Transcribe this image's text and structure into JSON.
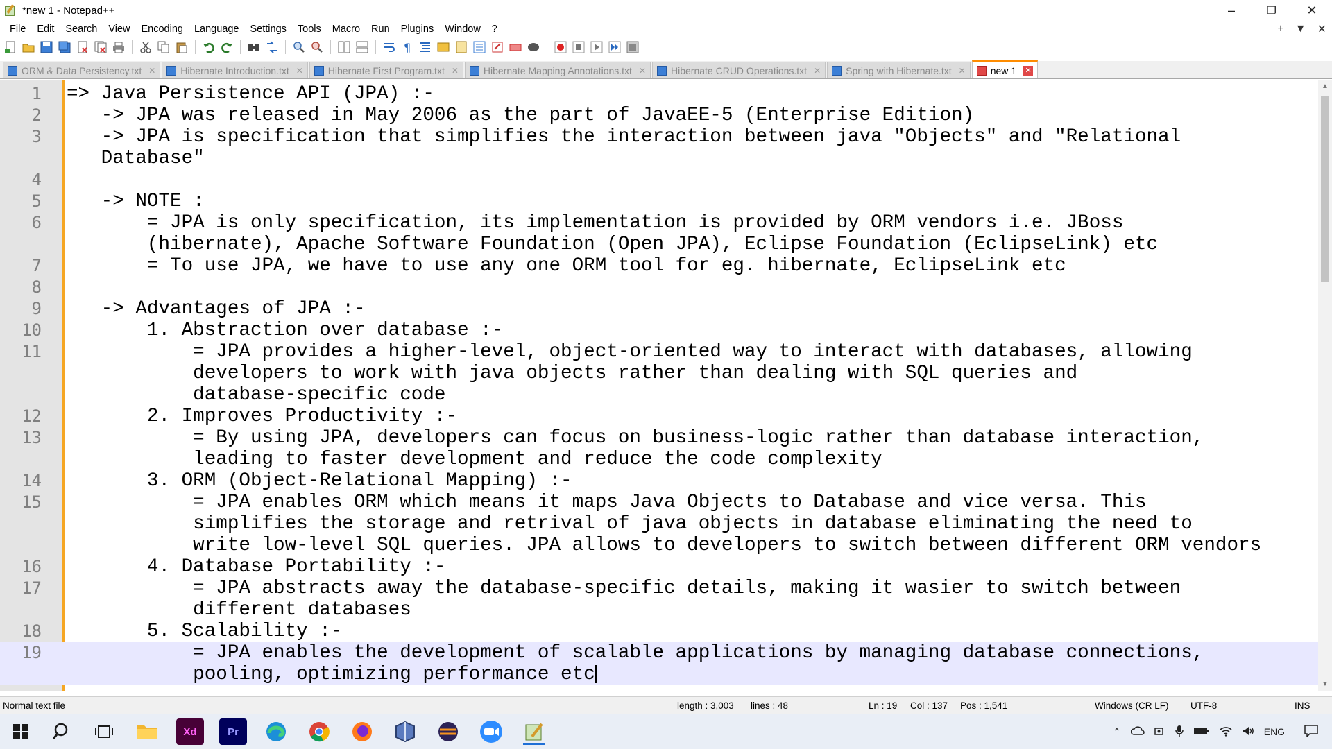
{
  "window": {
    "title": "*new 1 - Notepad++",
    "controls": {
      "minimize": "–",
      "restore": "❐",
      "close": "✕"
    }
  },
  "menu": [
    "File",
    "Edit",
    "Search",
    "View",
    "Encoding",
    "Language",
    "Settings",
    "Tools",
    "Macro",
    "Run",
    "Plugins",
    "Window",
    "?"
  ],
  "menu_right": {
    "plus": "+",
    "dropdown": "▼",
    "close": "✕"
  },
  "tabs": [
    {
      "label": "ORM & Data Persistency.txt",
      "active": false
    },
    {
      "label": "Hibernate Introduction.txt",
      "active": false
    },
    {
      "label": "Hibernate First Program.txt",
      "active": false
    },
    {
      "label": "Hibernate Mapping Annotations.txt",
      "active": false
    },
    {
      "label": "Hibernate CRUD Operations.txt",
      "active": false
    },
    {
      "label": "Spring with Hibernate.txt",
      "active": false
    },
    {
      "label": "new 1",
      "active": true
    }
  ],
  "editor": {
    "rows": [
      {
        "num": "1",
        "text": "=> Java Persistence API (JPA) :-"
      },
      {
        "num": "2",
        "text": "   -> JPA was released in May 2006 as the part of JavaEE-5 (Enterprise Edition)"
      },
      {
        "num": "3",
        "text": "   -> JPA is specification that simplifies the interaction between java \"Objects\" and \"Relational"
      },
      {
        "num": "",
        "text": "   Database\""
      },
      {
        "num": "4",
        "text": ""
      },
      {
        "num": "5",
        "text": "   -> NOTE :"
      },
      {
        "num": "6",
        "text": "       = JPA is only specification, its implementation is provided by ORM vendors i.e. JBoss"
      },
      {
        "num": "",
        "text": "       (hibernate), Apache Software Foundation (Open JPA), Eclipse Foundation (EclipseLink) etc"
      },
      {
        "num": "7",
        "text": "       = To use JPA, we have to use any one ORM tool for eg. hibernate, EclipseLink etc"
      },
      {
        "num": "8",
        "text": ""
      },
      {
        "num": "9",
        "text": "   -> Advantages of JPA :-"
      },
      {
        "num": "10",
        "text": "       1. Abstraction over database :-"
      },
      {
        "num": "11",
        "text": "           = JPA provides a higher-level, object-oriented way to interact with databases, allowing"
      },
      {
        "num": "",
        "text": "           developers to work with java objects rather than dealing with SQL queries and"
      },
      {
        "num": "",
        "text": "           database-specific code"
      },
      {
        "num": "12",
        "text": "       2. Improves Productivity :-"
      },
      {
        "num": "13",
        "text": "           = By using JPA, developers can focus on business-logic rather than database interaction,"
      },
      {
        "num": "",
        "text": "           leading to faster development and reduce the code complexity"
      },
      {
        "num": "14",
        "text": "       3. ORM (Object-Relational Mapping) :-"
      },
      {
        "num": "15",
        "text": "           = JPA enables ORM which means it maps Java Objects to Database and vice versa. This"
      },
      {
        "num": "",
        "text": "           simplifies the storage and retrival of java objects in database eliminating the need to"
      },
      {
        "num": "",
        "text": "           write low-level SQL queries. JPA allows to developers to switch between different ORM vendors"
      },
      {
        "num": "16",
        "text": "       4. Database Portability :-"
      },
      {
        "num": "17",
        "text": "           = JPA abstracts away the database-specific details, making it wasier to switch between"
      },
      {
        "num": "",
        "text": "           different databases"
      },
      {
        "num": "18",
        "text": "       5. Scalability :-"
      },
      {
        "num": "19",
        "text": "           = JPA enables the development of scalable applications by managing database connections,"
      },
      {
        "num": "",
        "text": "           pooling, optimizing performance etc"
      }
    ],
    "current_line": "19"
  },
  "status": {
    "file_type": "Normal text file",
    "length": "length : 3,003",
    "lines": "lines : 48",
    "ln": "Ln : 19",
    "col": "Col : 137",
    "pos": "Pos : 1,541",
    "eol": "Windows (CR LF)",
    "encoding": "UTF-8",
    "mode": "INS"
  },
  "taskbar": {
    "apps": [
      "start-icon",
      "search-icon",
      "task-view-icon",
      "file-explorer-icon",
      "adobe-xd-icon",
      "premiere-pro-icon",
      "edge-icon",
      "chrome-icon",
      "firefox-icon",
      "app-icon",
      "eclipse-icon",
      "zoom-icon",
      "notepadpp-icon"
    ],
    "xd_label": "Xd",
    "pr_label": "Pr",
    "language": "ENG"
  }
}
